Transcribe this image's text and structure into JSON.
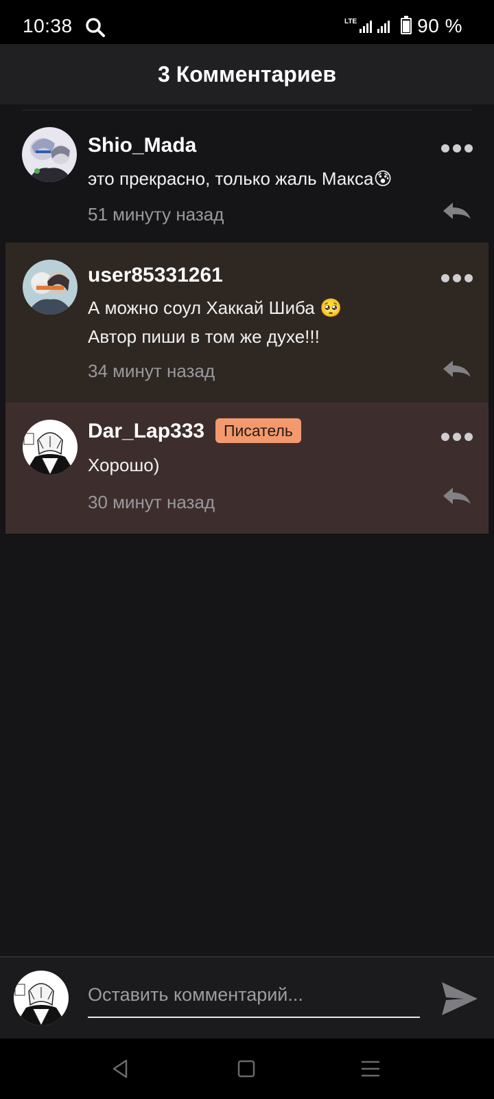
{
  "status_bar": {
    "time": "10:38",
    "network": "LTE",
    "battery": "90 %",
    "battery_level": 0.9
  },
  "header": {
    "title": "3 Комментариев"
  },
  "comments": [
    {
      "username": "Shio_Mada",
      "text_lines": [
        "это прекрасно, только жаль Макса😰"
      ],
      "timestamp": "51 минуту назад",
      "badge": null
    },
    {
      "username": "user85331261",
      "text_lines": [
        "А можно соул Хаккай Шиба 🥺",
        "Автор пиши в том же духе!!!"
      ],
      "timestamp": "34 минут назад",
      "badge": null
    },
    {
      "username": "Dar_Lap333",
      "text_lines": [
        "Хорошо)"
      ],
      "timestamp": "30 минут назад",
      "badge": "Писатель"
    }
  ],
  "input": {
    "placeholder": "Оставить комментарий..."
  },
  "colors": {
    "background": "#151416",
    "header": "#201f21",
    "comment2_bg": "#2e2722",
    "comment3_bg": "#3d2e2d",
    "badge": "#f29a6e"
  },
  "icons": {
    "search": "search-icon",
    "more": "more-horizontal-icon",
    "reply": "reply-icon",
    "send": "send-icon",
    "nav_back": "back-triangle-icon",
    "nav_home": "home-square-icon",
    "nav_recents": "menu-lines-icon"
  }
}
